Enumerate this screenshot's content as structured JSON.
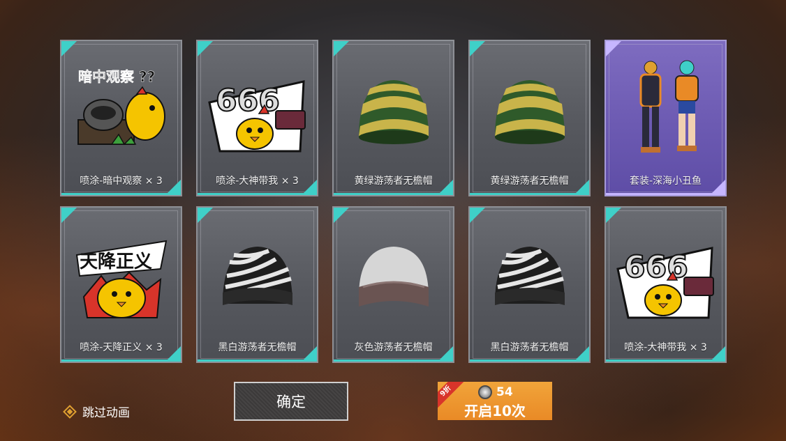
{
  "cards": [
    {
      "name": "喷涂-暗中观察 × 3",
      "art": "spray-hidden-chicken",
      "rarity": "normal"
    },
    {
      "name": "喷涂-大神带我 × 3",
      "art": "spray-666-chicken",
      "rarity": "normal"
    },
    {
      "name": "黄绿游荡者无檐帽",
      "art": "beanie-yellow-green",
      "rarity": "normal"
    },
    {
      "name": "黄绿游荡者无檐帽",
      "art": "beanie-yellow-green",
      "rarity": "normal"
    },
    {
      "name": "套装-深海小丑鱼",
      "art": "outfit-clownfish",
      "rarity": "legendary"
    },
    {
      "name": "喷涂-天降正义 × 3",
      "art": "spray-justice-chicken",
      "rarity": "normal"
    },
    {
      "name": "黑白游荡者无檐帽",
      "art": "beanie-black-white",
      "rarity": "normal"
    },
    {
      "name": "灰色游荡者无檐帽",
      "art": "beanie-grey",
      "rarity": "normal"
    },
    {
      "name": "黑白游荡者无檐帽",
      "art": "beanie-black-white",
      "rarity": "normal"
    },
    {
      "name": "喷涂-大神带我 × 3",
      "art": "spray-666-chicken",
      "rarity": "normal"
    }
  ],
  "spray_text": {
    "hidden": "暗中观察 ??",
    "six": "666",
    "justice": "天降正义"
  },
  "skip": {
    "label": "跳过动画",
    "icon": "diamond-icon"
  },
  "confirm": {
    "label": "确定"
  },
  "open_ten": {
    "discount": "9折",
    "price": "54",
    "label": "开启10次",
    "currency_icon": "coin-icon"
  },
  "colors": {
    "common_accent": "#3fd0c8",
    "legendary_accent": "#c6b6ff",
    "button_orange": "#e98a26"
  }
}
